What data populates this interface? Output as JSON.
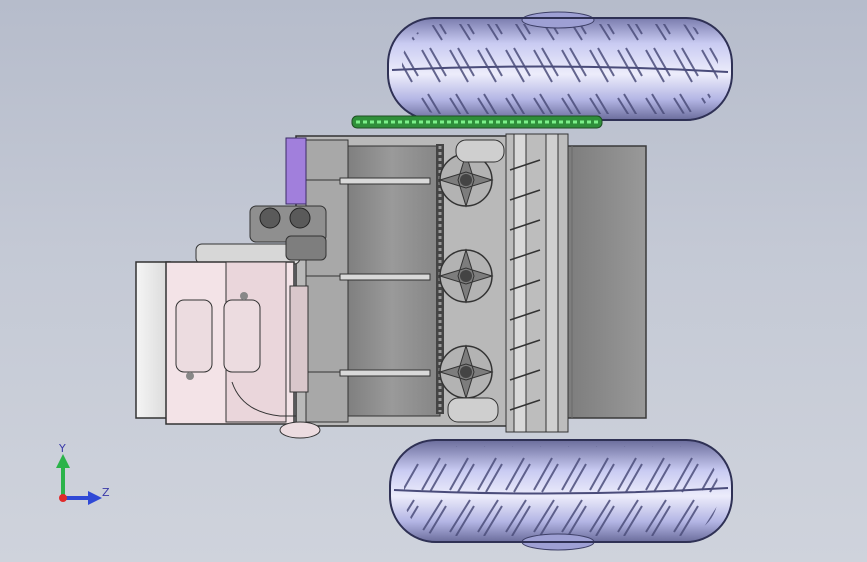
{
  "triad": {
    "y_label": "Y",
    "z_label": "Z"
  },
  "colors": {
    "background": "#c2c7d3",
    "tire": "#b7b9e6",
    "tire_dark": "#5a5c8c",
    "frame": "#8e8e8e",
    "housing": "#f2e2e6",
    "chain_green": "#39c84a",
    "accent_purple": "#9a78d6",
    "axis_y": "#2bb34a",
    "axis_z": "#2f49d6",
    "axis_origin": "#e02a2a"
  }
}
